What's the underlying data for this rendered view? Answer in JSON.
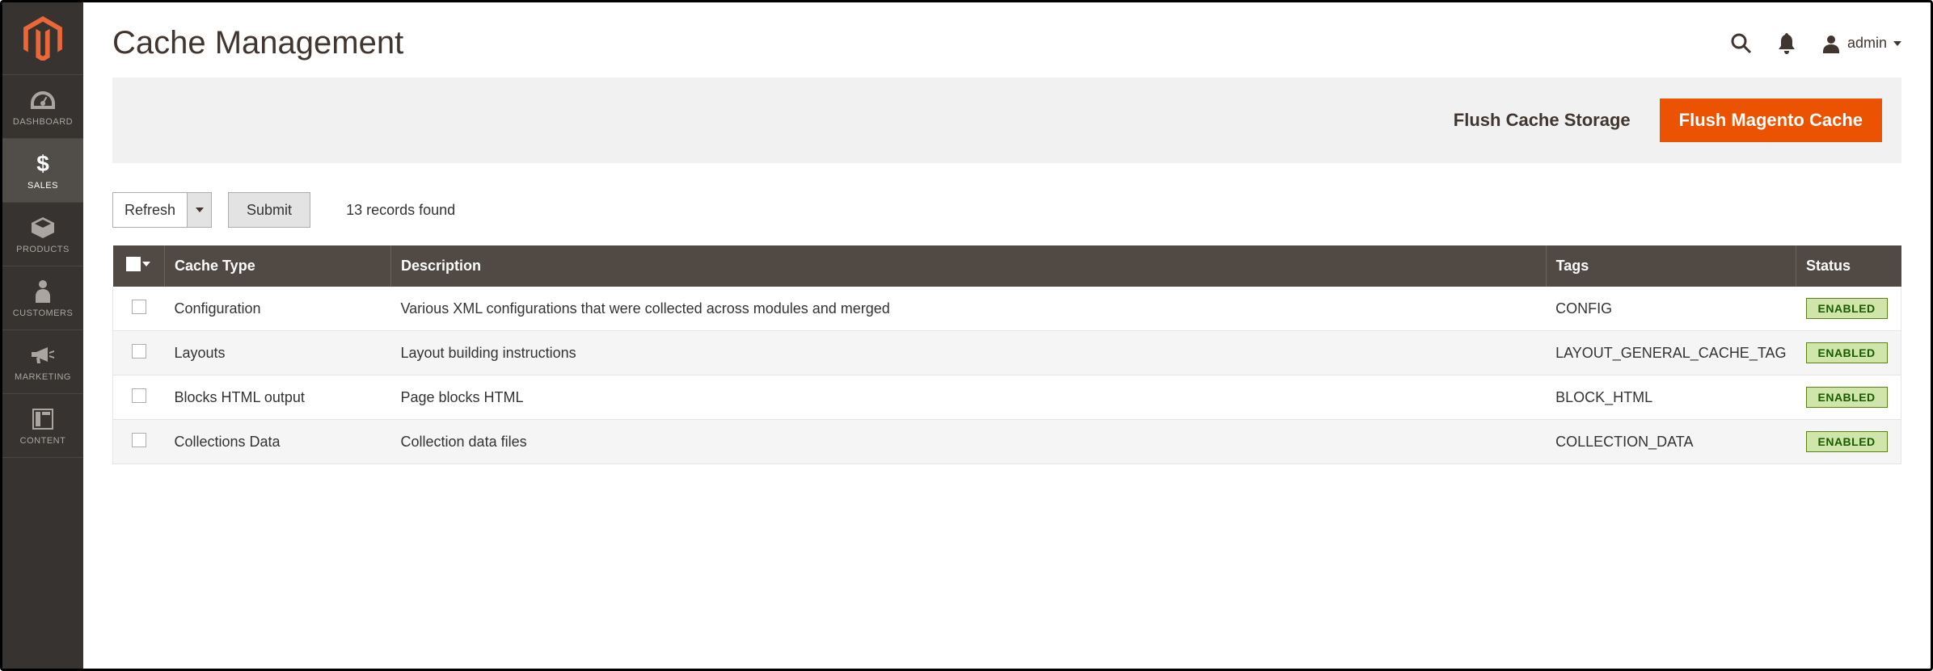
{
  "sidebar": {
    "items": [
      {
        "label": "DASHBOARD",
        "icon": "gauge"
      },
      {
        "label": "SALES",
        "icon": "dollar"
      },
      {
        "label": "PRODUCTS",
        "icon": "box"
      },
      {
        "label": "CUSTOMERS",
        "icon": "person"
      },
      {
        "label": "MARKETING",
        "icon": "megaphone"
      },
      {
        "label": "CONTENT",
        "icon": "layout"
      }
    ]
  },
  "header": {
    "title": "Cache Management",
    "user_label": "admin"
  },
  "actions": {
    "flush_storage": "Flush Cache Storage",
    "flush_magento": "Flush Magento Cache"
  },
  "toolbar": {
    "action_select": "Refresh",
    "submit": "Submit",
    "records_found": "13 records found"
  },
  "table": {
    "columns": {
      "type": "Cache Type",
      "description": "Description",
      "tags": "Tags",
      "status": "Status"
    },
    "rows": [
      {
        "type": "Configuration",
        "description": "Various XML configurations that were collected across modules and merged",
        "tags": "CONFIG",
        "status": "ENABLED"
      },
      {
        "type": "Layouts",
        "description": "Layout building instructions",
        "tags": "LAYOUT_GENERAL_CACHE_TAG",
        "status": "ENABLED"
      },
      {
        "type": "Blocks HTML output",
        "description": "Page blocks HTML",
        "tags": "BLOCK_HTML",
        "status": "ENABLED"
      },
      {
        "type": "Collections Data",
        "description": "Collection data files",
        "tags": "COLLECTION_DATA",
        "status": "ENABLED"
      }
    ]
  }
}
